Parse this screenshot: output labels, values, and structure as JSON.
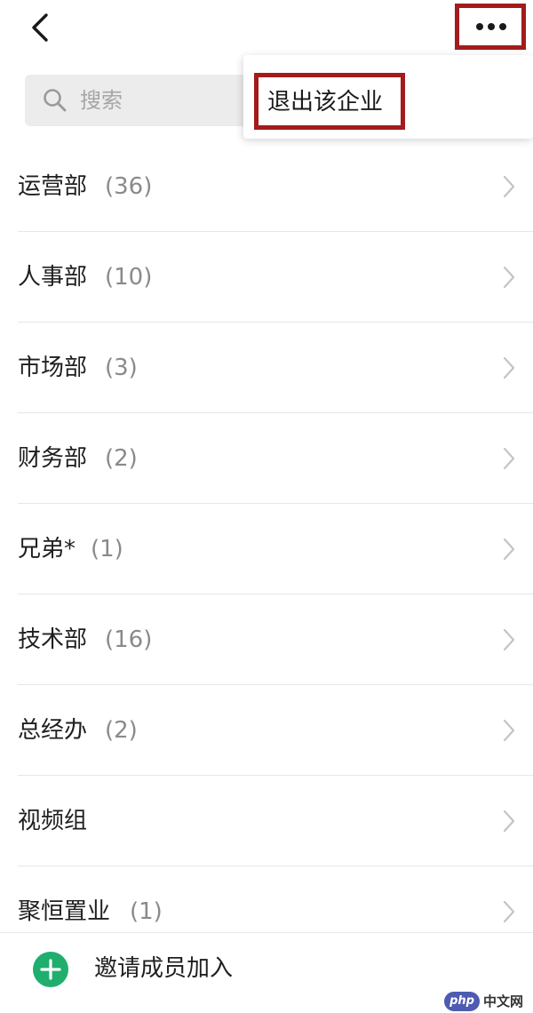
{
  "header": {
    "back_icon": "chevron-left-icon",
    "more_icon": "more-dots-icon",
    "highlight_color": "#a31b1b"
  },
  "search": {
    "placeholder": "搜索",
    "icon": "search-icon"
  },
  "menu": {
    "items": [
      {
        "label": "退出该企业"
      }
    ]
  },
  "departments": [
    {
      "name": "运营部",
      "count": "(36)"
    },
    {
      "name": "人事部",
      "count": "(10)"
    },
    {
      "name": "市场部",
      "count": "(3)"
    },
    {
      "name": "财务部",
      "count": "(2)"
    },
    {
      "name": "兄弟*",
      "count": "(1)"
    },
    {
      "name": "技术部",
      "count": "(16)"
    },
    {
      "name": "总经办",
      "count": "(2)"
    },
    {
      "name": "视频组",
      "count": ""
    },
    {
      "name": "聚恒置业",
      "count": "(1)"
    }
  ],
  "footer": {
    "invite_label": "邀请成员加入",
    "plus_icon": "plus-circle-icon",
    "accent_color": "#1fae6e"
  },
  "watermark": {
    "logo_text": "php",
    "site_text": "中文网"
  }
}
